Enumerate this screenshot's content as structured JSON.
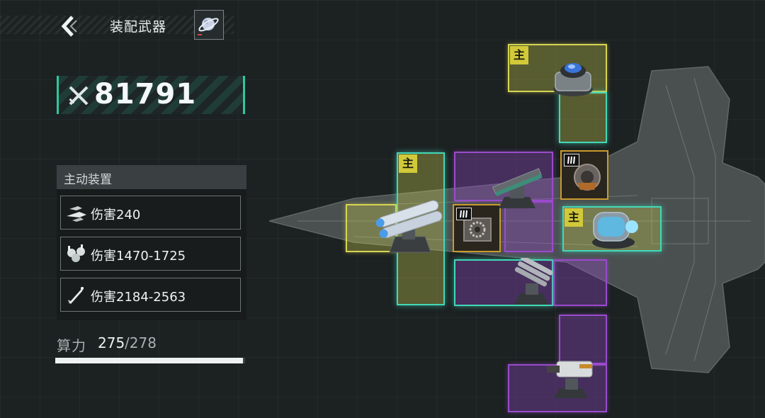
{
  "header": {
    "title": "装配武器",
    "back_icon": "back-chevron-icon",
    "planet_icon": "planet-icon"
  },
  "power": {
    "value": "81791",
    "icon": "crossed-swords-icon",
    "accent": "#2fc7a0"
  },
  "active_devices": {
    "title": "主动装置",
    "items": [
      {
        "label": "伤害240",
        "icon": "fighter-squadron-icon"
      },
      {
        "label": "伤害1470-1725",
        "icon": "turret-cluster-icon"
      },
      {
        "label": "伤害2184-2563",
        "icon": "missile-icon"
      }
    ]
  },
  "compute": {
    "label": "算力",
    "used": "275",
    "total": "/278",
    "fraction": 0.989
  },
  "slots": {
    "main_badge": "主",
    "colors": {
      "main": "#d6d452",
      "secondary": "#9a4bcc",
      "highlight": "#43d8b8",
      "module_border": "#c99a2d"
    }
  }
}
